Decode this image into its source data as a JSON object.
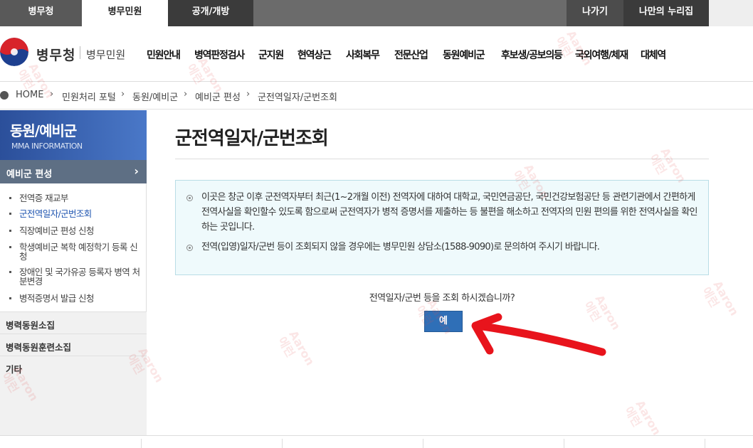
{
  "top_tabs": [
    "병무청",
    "병무민원",
    "공개/개방"
  ],
  "top_right": [
    "나가기",
    "나만의 누리집"
  ],
  "brand": {
    "name": "병무청",
    "sub": "병무민원"
  },
  "gnb": [
    "민원안내",
    "병역판정검사",
    "군지원",
    "현역상근",
    "사회복무",
    "전문산업",
    "동원예비군",
    "후보생/공보의등",
    "국외여행/체재",
    "대체역"
  ],
  "breadcrumb": [
    "HOME",
    "민원처리 포털",
    "동원/예비군",
    "예비군 편성",
    "군전역일자/군번조회"
  ],
  "sidebar": {
    "title": "동원/예비군",
    "subtitle": "MMA INFORMATION",
    "active_section": "예비군 편성",
    "items": [
      "전역증 재교부",
      "군전역일자/군번조회",
      "직장예비군 편성 신청",
      "학생예비군 복학 예정학기 등록 신청",
      "장애인 및 국가유공 등록자 병역 처분변경",
      "병적증명서 발급 신청"
    ],
    "sections": [
      "병력동원소집",
      "병력동원훈련소집",
      "기타"
    ]
  },
  "main": {
    "title": "군전역일자/군번조회",
    "notice": [
      "이곳은 창군 이후 군전역자부터 최근(1~2개월 이전) 전역자에 대하여 대학교, 국민연금공단, 국민건강보험공단 등 관련기관에서 간편하게 전역사실을 확인할수 있도록 함으로써 군전역자가 병적 증명서를 제출하는 등 불편을 해소하고 전역자의 민원 편의를 위한 전역사실을 확인하는 곳입니다.",
      "전역(입영)일자/군번 등이 조회되지 않을 경우에는 병무민원 상담소(1588-9090)로 문의하여 주시기 바랍니다."
    ],
    "question": "전역일자/군번 등을 조회 하시겠습니까?",
    "yes_button": "예"
  },
  "watermark": {
    "text1": "Aaron",
    "text2": "에런"
  },
  "colors": {
    "nav_active": "#ffffff",
    "sidebar_head": "#2b4f9a",
    "button": "#2f6fb7",
    "notice_bg": "#effafc",
    "annotation_arrow": "#e8141c"
  }
}
